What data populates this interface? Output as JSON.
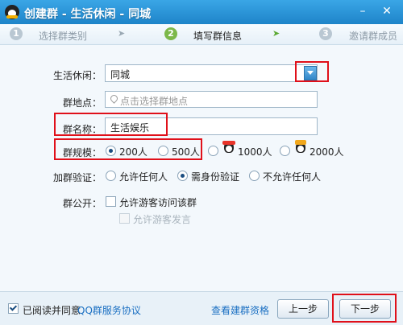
{
  "window": {
    "title": "创建群 - 生活休闲 - 同城",
    "minimize": "–",
    "close": "✕"
  },
  "steps": [
    {
      "num": "1",
      "label": "选择群类别"
    },
    {
      "num": "2",
      "label": "填写群信息"
    },
    {
      "num": "3",
      "label": "邀请群成员"
    }
  ],
  "form": {
    "category_label": "生活休闲：",
    "category_value": "同城",
    "location_label": "群地点：",
    "location_placeholder": "点击选择群地点",
    "name_label": "群名称：",
    "name_value": "生活娱乐",
    "size_label": "群规模：",
    "sizes": [
      "200人",
      "500人",
      "1000人",
      "2000人"
    ],
    "verify_label": "加群验证：",
    "verify_options": [
      "允许任何人",
      "需身份验证",
      "不允许任何人"
    ],
    "public_label": "群公开：",
    "public_option": "允许游客访问该群",
    "public_sub_option": "允许游客发言"
  },
  "footer": {
    "agree_text": "已阅读并同意",
    "agree_link": "QQ群服务协议",
    "view_link": "查看建群资格",
    "prev_button": "上一步",
    "next_button": "下一步"
  },
  "colors": {
    "accent": "#1e84c9",
    "highlight": "#e0101a",
    "link": "#1a6fc2"
  }
}
